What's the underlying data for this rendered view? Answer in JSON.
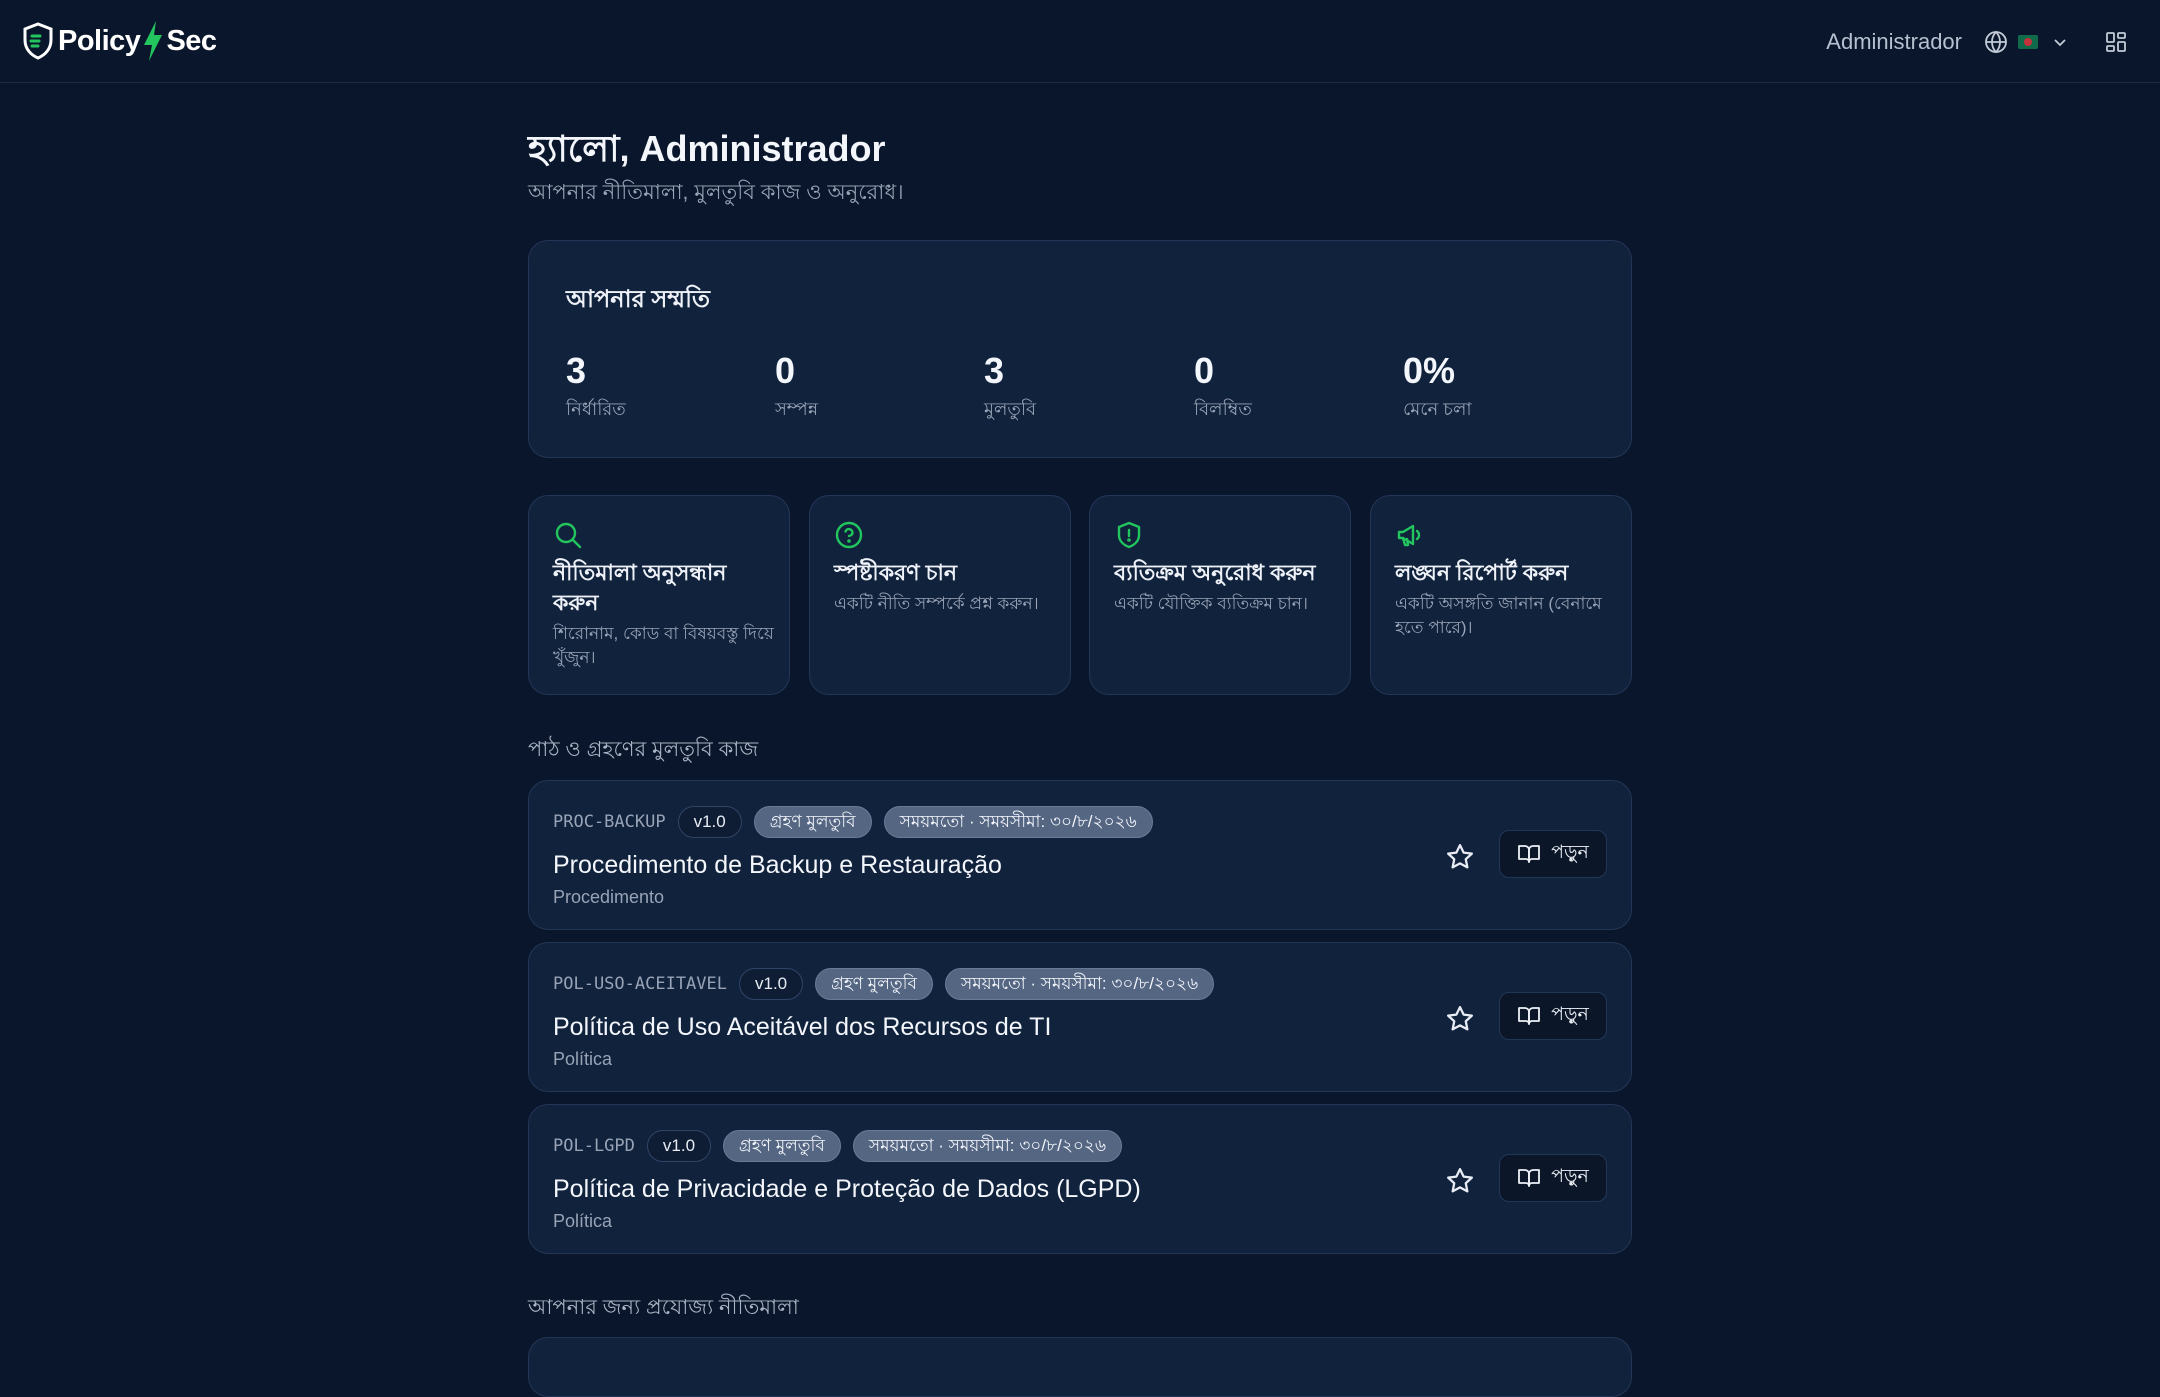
{
  "app": {
    "brand_left": "Policy",
    "brand_right": "Sec",
    "user_name": "Administrador"
  },
  "header": {
    "greeting": "হ্যালো, Administrador",
    "subtitle": "আপনার নীতিমালা, মুলতুবি কাজ ও অনুরোধ।"
  },
  "summary": {
    "title": "আপনার সম্মতি",
    "stats": [
      {
        "value": "3",
        "label": "নির্ধারিত"
      },
      {
        "value": "0",
        "label": "সম্পন্ন"
      },
      {
        "value": "3",
        "label": "মুলতুবি"
      },
      {
        "value": "0",
        "label": "বিলম্বিত"
      },
      {
        "value": "0%",
        "label": "মেনে চলা"
      }
    ]
  },
  "actions": [
    {
      "title": "নীতিমালা অনুসন্ধান করুন",
      "desc": "শিরোনাম, কোড বা বিষয়বস্তু দিয়ে খুঁজুন।",
      "icon": "search-icon"
    },
    {
      "title": "স্পষ্টীকরণ চান",
      "desc": "একটি নীতি সম্পর্কে প্রশ্ন করুন।",
      "icon": "help-circle-icon"
    },
    {
      "title": "ব্যতিক্রম অনুরোধ করুন",
      "desc": "একটি যৌক্তিক ব্যতিক্রম চান।",
      "icon": "shield-alert-icon"
    },
    {
      "title": "লঙ্ঘন রিপোর্ট করুন",
      "desc": "একটি অসঙ্গতি জানান (বেনামে হতে পারে)।",
      "icon": "megaphone-icon"
    }
  ],
  "pending_section": {
    "title": "পাঠ ও গ্রহণের মুলতুবি কাজ",
    "tasks": [
      {
        "code": "PROC-BACKUP",
        "version": "v1.0",
        "status": "গ্রহণ মুলতুবি",
        "deadline": "সময়মতো · সময়সীমা: ৩০/৮/২০২৬",
        "title": "Procedimento de Backup e Restauração",
        "type": "Procedimento",
        "read_label": "পড়ুন"
      },
      {
        "code": "POL-USO-ACEITAVEL",
        "version": "v1.0",
        "status": "গ্রহণ মুলতুবি",
        "deadline": "সময়মতো · সময়সীমা: ৩০/৮/২০২৬",
        "title": "Política de Uso Aceitável dos Recursos de TI",
        "type": "Política",
        "read_label": "পড়ুন"
      },
      {
        "code": "POL-LGPD",
        "version": "v1.0",
        "status": "গ্রহণ মুলতুবি",
        "deadline": "সময়মতো · সময়সীমা: ৩০/৮/২০২৬",
        "title": "Política de Privacidade e Proteção de Dados (LGPD)",
        "type": "Política",
        "read_label": "পড়ুন"
      }
    ]
  },
  "applicable_section": {
    "title": "আপনার জন্য প্রযোজ্য নীতিমালা"
  },
  "colors": {
    "background": "#0a162b",
    "card": "#11223c",
    "accent": "#22c55e"
  }
}
